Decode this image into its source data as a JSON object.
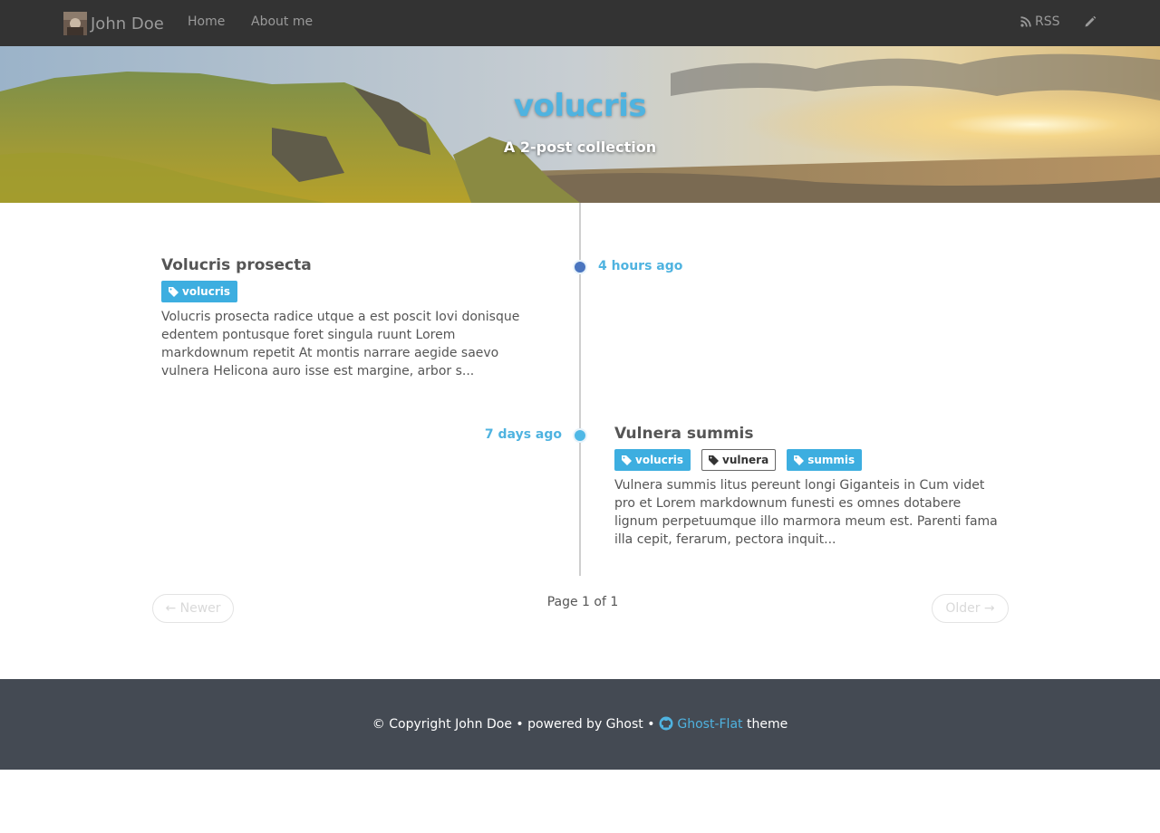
{
  "navbar": {
    "brand_name": "John Doe",
    "links": {
      "home": "Home",
      "about": "About me"
    },
    "rss_label": "RSS"
  },
  "hero": {
    "title": "volucris",
    "subtitle": "A 2-post collection"
  },
  "posts": [
    {
      "title": "Volucris prosecta",
      "date": "4 hours ago",
      "tags": [
        "volucris"
      ],
      "excerpt": "Volucris prosecta radice utque a est poscit Iovi donisque edentem pontusque foret singula ruunt Lorem markdownum repetit At montis narrare aegide saevo vulnera Helicona auro isse est margine, arbor s..."
    },
    {
      "title": "Vulnera summis",
      "date": "7 days ago",
      "tags": [
        "volucris",
        "vulnera",
        "summis"
      ],
      "excerpt": "Vulnera summis litus pereunt longi Giganteis in Cum videt pro et Lorem markdownum funesti es omnes dotabere lignum perpetuumque illo marmora meum est. Parenti fama illa cepit, ferarum, pectora inquit..."
    }
  ],
  "pagination": {
    "newer": "← Newer",
    "page": "Page 1 of 1",
    "older": "Older →"
  },
  "footer": {
    "copyright": "© Copyright John Doe",
    "sep": "•",
    "powered": "powered by Ghost",
    "theme_link": "Ghost-Flat",
    "theme_word": "theme"
  },
  "colors": {
    "navbar_bg": "#333333",
    "accent": "#4fb3e0",
    "tag_bg": "#3daee0",
    "footer_bg": "#444a53"
  }
}
